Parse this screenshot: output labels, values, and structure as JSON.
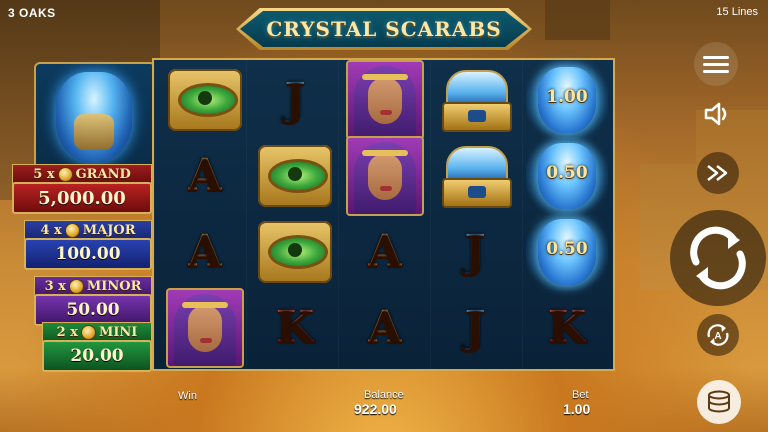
{
  "studio": "3 OAKS",
  "lines": "15 Lines",
  "title": "CRYSTAL SCARABS",
  "jackpots": {
    "grand": {
      "multiplier": "5 x",
      "name": "GRAND",
      "value": "5,000.00"
    },
    "major": {
      "multiplier": "4 x",
      "name": "MAJOR",
      "value": "100.00"
    },
    "minor": {
      "multiplier": "3 x",
      "name": "MINOR",
      "value": "50.00"
    },
    "mini": {
      "multiplier": "2 x",
      "name": "MINI",
      "value": "20.00"
    }
  },
  "reels": [
    [
      {
        "symbol": "eye-of-horus"
      },
      {
        "symbol": "A"
      },
      {
        "symbol": "A"
      },
      {
        "symbol": "queen"
      }
    ],
    [
      {
        "symbol": "J"
      },
      {
        "symbol": "eye-of-horus"
      },
      {
        "symbol": "eye-of-horus"
      },
      {
        "symbol": "K"
      }
    ],
    [
      {
        "symbol": "queen"
      },
      {
        "symbol": "queen"
      },
      {
        "symbol": "A"
      },
      {
        "symbol": "A"
      }
    ],
    [
      {
        "symbol": "crown"
      },
      {
        "symbol": "crown"
      },
      {
        "symbol": "J"
      },
      {
        "symbol": "J"
      }
    ],
    [
      {
        "symbol": "scarab",
        "value": "1.00"
      },
      {
        "symbol": "scarab",
        "value": "0.50"
      },
      {
        "symbol": "scarab",
        "value": "0.50"
      },
      {
        "symbol": "K"
      }
    ]
  ],
  "footer": {
    "win_label": "Win",
    "balance_label": "Balance",
    "balance_value": "922.00",
    "bet_label": "Bet",
    "bet_value": "1.00"
  },
  "buttons": {
    "menu": "menu-icon",
    "sound": "speaker-icon",
    "turbo": "fast-forward-icon",
    "spin": "spin-icon",
    "autoplay": "autoplay-icon",
    "bet": "coins-icon"
  },
  "colors": {
    "frame_gold": "#d4aa4f",
    "grand": "#b82222",
    "major": "#2842b0",
    "minor": "#7634ad",
    "mini": "#22963f"
  }
}
